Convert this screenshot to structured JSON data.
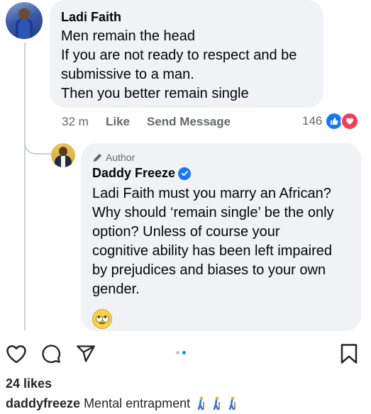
{
  "comment1": {
    "author": "Ladi Faith",
    "lines": [
      "Men remain the head",
      "If you are not ready to respect and be",
      "submissive to a man.",
      "Then you better remain single"
    ],
    "time": "32 m",
    "like_label": "Like",
    "send_message_label": "Send Message",
    "reaction_count": "146",
    "reactions": [
      "like-icon",
      "love-icon"
    ]
  },
  "reply": {
    "author_tag": "Author",
    "author": "Daddy Freeze",
    "verified_icon": "verified-badge-icon",
    "lines": [
      "Ladi Faith must you marry an African?",
      "Why should ‘remain single’ be the only",
      "option? Unless of course your",
      "cognitive ability has been left impaired",
      "by prejudices and biases to your own",
      "gender."
    ],
    "emoji": "face-with-rolling-eyes"
  },
  "post": {
    "likes": "24 likes",
    "caption_user": "daddyfreeze",
    "caption_text": "Mental entrapment",
    "caption_emoji": [
      "person-walking-with-cane",
      "person-walking-with-cane",
      "person-walking-with-cane"
    ],
    "carousel_dots": 2,
    "carousel_active": 2
  },
  "colors": {
    "bubble": "#f0f2f5",
    "facebook_blue": "#1877f2",
    "love_red": "#f33e58",
    "instagram_blue": "#0095f6",
    "meta_gray": "#65676b"
  }
}
